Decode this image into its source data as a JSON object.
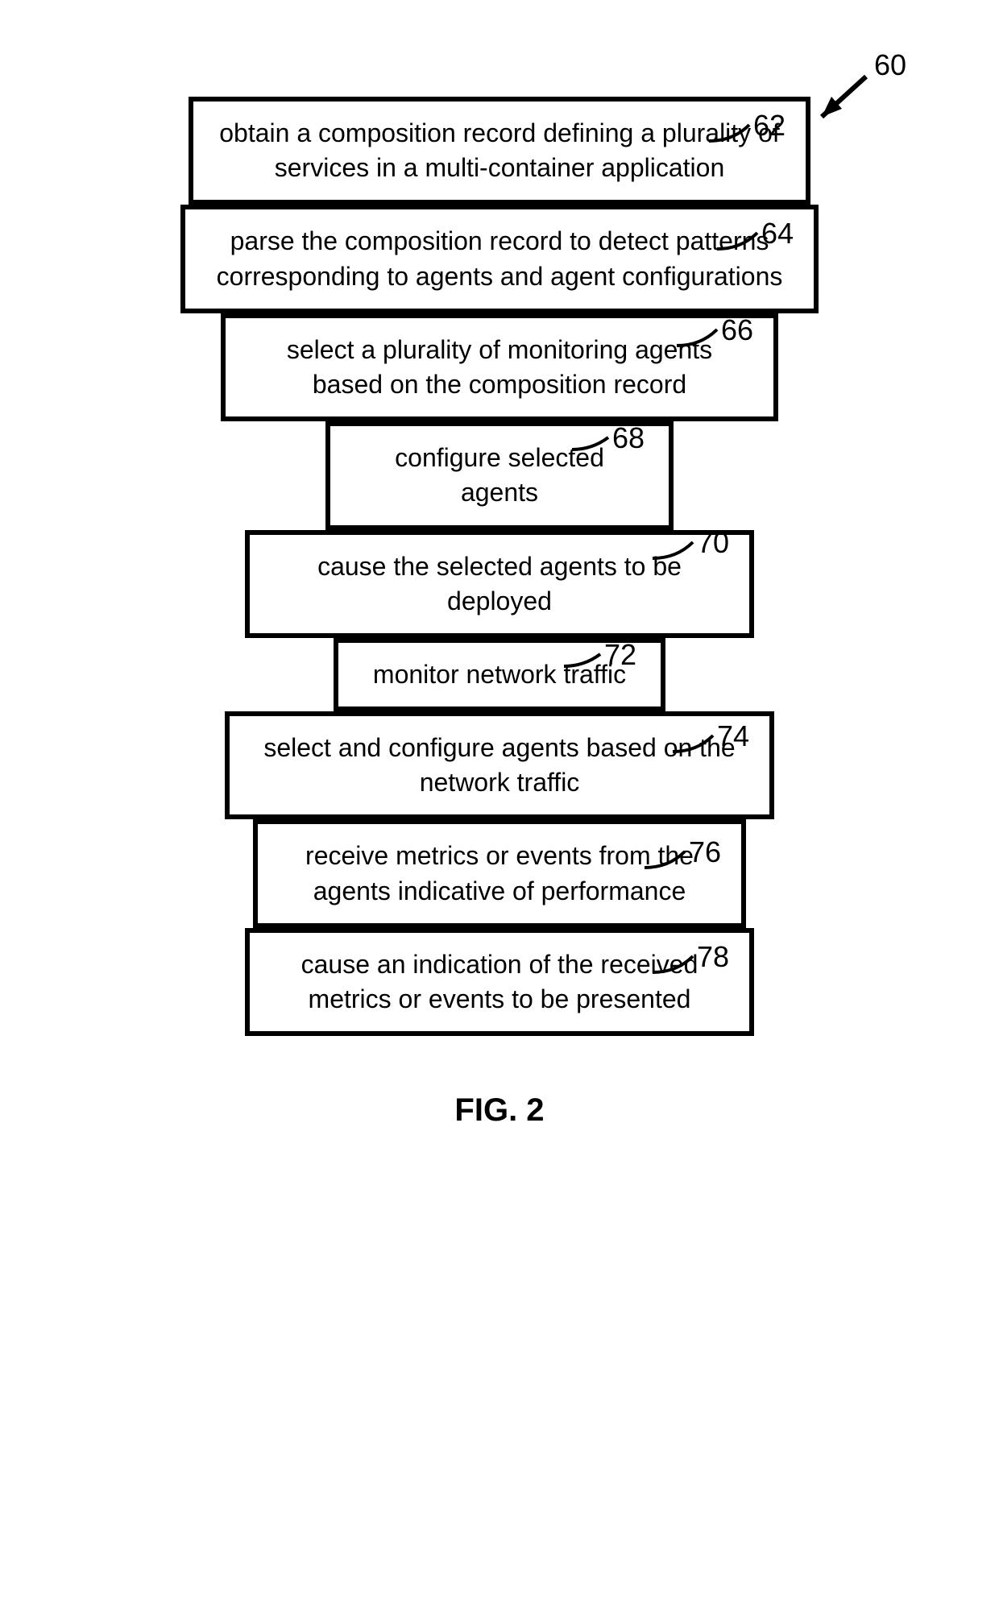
{
  "figure_label": "FIG. 2",
  "ref_main": "60",
  "steps": [
    {
      "ref": "62",
      "text": "obtain a composition record defining a plurality of services in a multi-container application"
    },
    {
      "ref": "64",
      "text": "parse the composition record to detect patterns corresponding to agents and agent configurations"
    },
    {
      "ref": "66",
      "text": "select a plurality of monitoring agents based on the composition record"
    },
    {
      "ref": "68",
      "text": "configure selected agents"
    },
    {
      "ref": "70",
      "text": "cause the selected agents to be deployed"
    },
    {
      "ref": "72",
      "text": "monitor network traffic"
    },
    {
      "ref": "74",
      "text": "select and configure agents based on the network traffic"
    },
    {
      "ref": "76",
      "text": "receive metrics or events from the agents indicative of performance"
    },
    {
      "ref": "78",
      "text": "cause an indication of the received metrics or events to be presented"
    }
  ]
}
